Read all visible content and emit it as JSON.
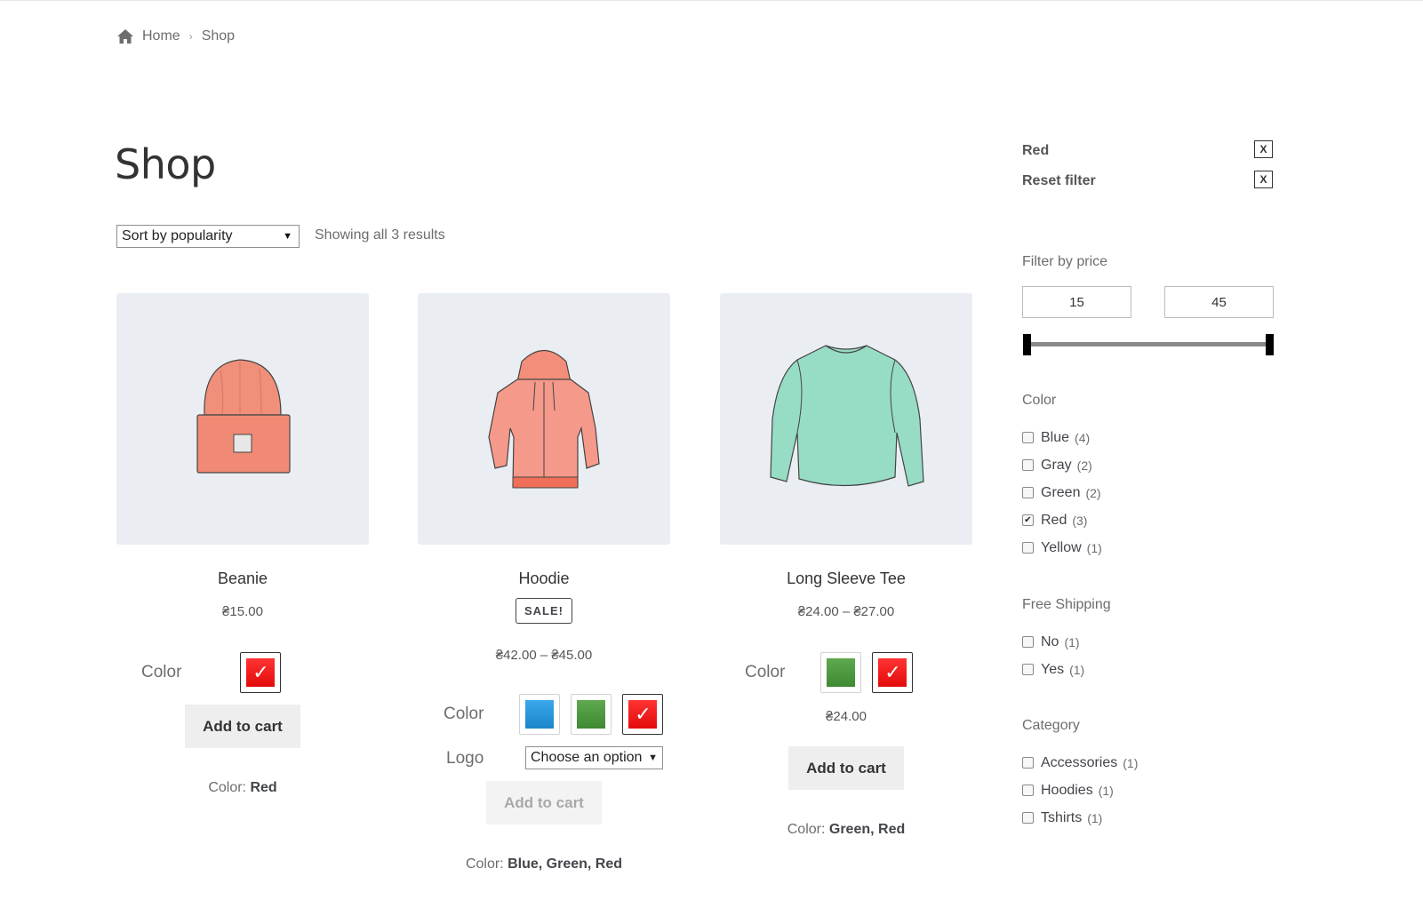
{
  "breadcrumb": {
    "home": "Home",
    "separator": "›",
    "current": "Shop"
  },
  "page": {
    "title": "Shop"
  },
  "toolbar": {
    "sort_value": "Sort by popularity",
    "result_count": "Showing all 3 results"
  },
  "products": [
    {
      "name": "Beanie",
      "price": "₴15.00",
      "swatch_label": "Color",
      "swatches": [
        {
          "color": "red",
          "hex": "#ff2222",
          "selected": true
        }
      ],
      "variation_price": "",
      "button": "Add to cart",
      "meta_label": "Color: ",
      "meta_value": "Red"
    },
    {
      "name": "Hoodie",
      "sale_badge": "SALE!",
      "price": "₴42.00 – ₴45.00",
      "swatch_label": "Color",
      "swatches": [
        {
          "color": "blue",
          "hex": "#2196e0",
          "selected": false
        },
        {
          "color": "green",
          "hex": "#4a9a3d",
          "selected": false
        },
        {
          "color": "red",
          "hex": "#ff2222",
          "selected": true
        }
      ],
      "logo_label": "Logo",
      "logo_select": "Choose an option",
      "button": "Add to cart",
      "meta_label": "Color: ",
      "meta_value": "Blue, Green, Red"
    },
    {
      "name": "Long Sleeve Tee",
      "price": "₴24.00 – ₴27.00",
      "swatch_label": "Color",
      "swatches": [
        {
          "color": "green",
          "hex": "#4a9a3d",
          "selected": false
        },
        {
          "color": "red",
          "hex": "#ff2222",
          "selected": true
        }
      ],
      "variation_price": "₴24.00",
      "button": "Add to cart",
      "meta_label": "Color: ",
      "meta_value": "Green, Red"
    }
  ],
  "sidebar": {
    "active_filters": [
      {
        "label": "Red",
        "remove": "X"
      },
      {
        "label": "Reset filter",
        "remove": "X"
      }
    ],
    "price_filter": {
      "title": "Filter by price",
      "min": "15",
      "max": "45"
    },
    "color_filter": {
      "title": "Color",
      "items": [
        {
          "label": "Blue",
          "count": "(4)",
          "checked": false
        },
        {
          "label": "Gray",
          "count": "(2)",
          "checked": false
        },
        {
          "label": "Green",
          "count": "(2)",
          "checked": false
        },
        {
          "label": "Red",
          "count": "(3)",
          "checked": true
        },
        {
          "label": "Yellow",
          "count": "(1)",
          "checked": false
        }
      ]
    },
    "shipping_filter": {
      "title": "Free Shipping",
      "items": [
        {
          "label": "No",
          "count": "(1)",
          "checked": false
        },
        {
          "label": "Yes",
          "count": "(1)",
          "checked": false
        }
      ]
    },
    "category_filter": {
      "title": "Category",
      "items": [
        {
          "label": "Accessories",
          "count": "(1)",
          "checked": false
        },
        {
          "label": "Hoodies",
          "count": "(1)",
          "checked": false
        },
        {
          "label": "Tshirts",
          "count": "(1)",
          "checked": false
        }
      ]
    }
  }
}
